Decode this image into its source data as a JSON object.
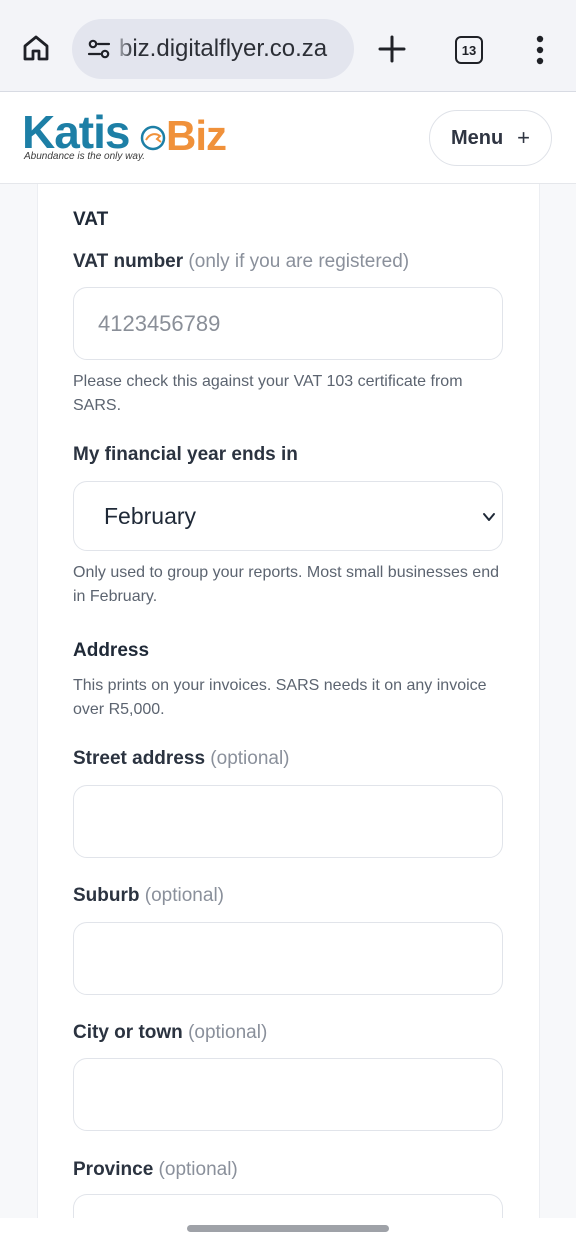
{
  "browser": {
    "url": "biz.digitalflyer.co.za",
    "tab_count": "13"
  },
  "site": {
    "logo_primary": "Katis",
    "logo_secondary": "Biz",
    "logo_tagline": "Abundance is the only way.",
    "menu_label": "Menu",
    "menu_icon": "+"
  },
  "form": {
    "vat_heading": "VAT",
    "vat_number_label": "VAT number",
    "vat_number_optional": "(only if you are registered)",
    "vat_number_placeholder": "4123456789",
    "vat_help": "Please check this against your VAT 103 certificate from SARS.",
    "financial_year_label": "My financial year ends in",
    "financial_year_value": "February",
    "financial_year_help": "Only used to group your reports. Most small businesses end in February.",
    "address_heading": "Address",
    "address_help": "This prints on your invoices. SARS needs it on any invoice over R5,000.",
    "street_label": "Street address",
    "street_optional": "(optional)",
    "suburb_label": "Suburb",
    "suburb_optional": "(optional)",
    "city_label": "City or town",
    "city_optional": "(optional)",
    "province_label": "Province",
    "province_optional": "(optional)"
  },
  "colors": {
    "logo_blue": "#1d7fa6",
    "logo_orange": "#f0913a"
  }
}
